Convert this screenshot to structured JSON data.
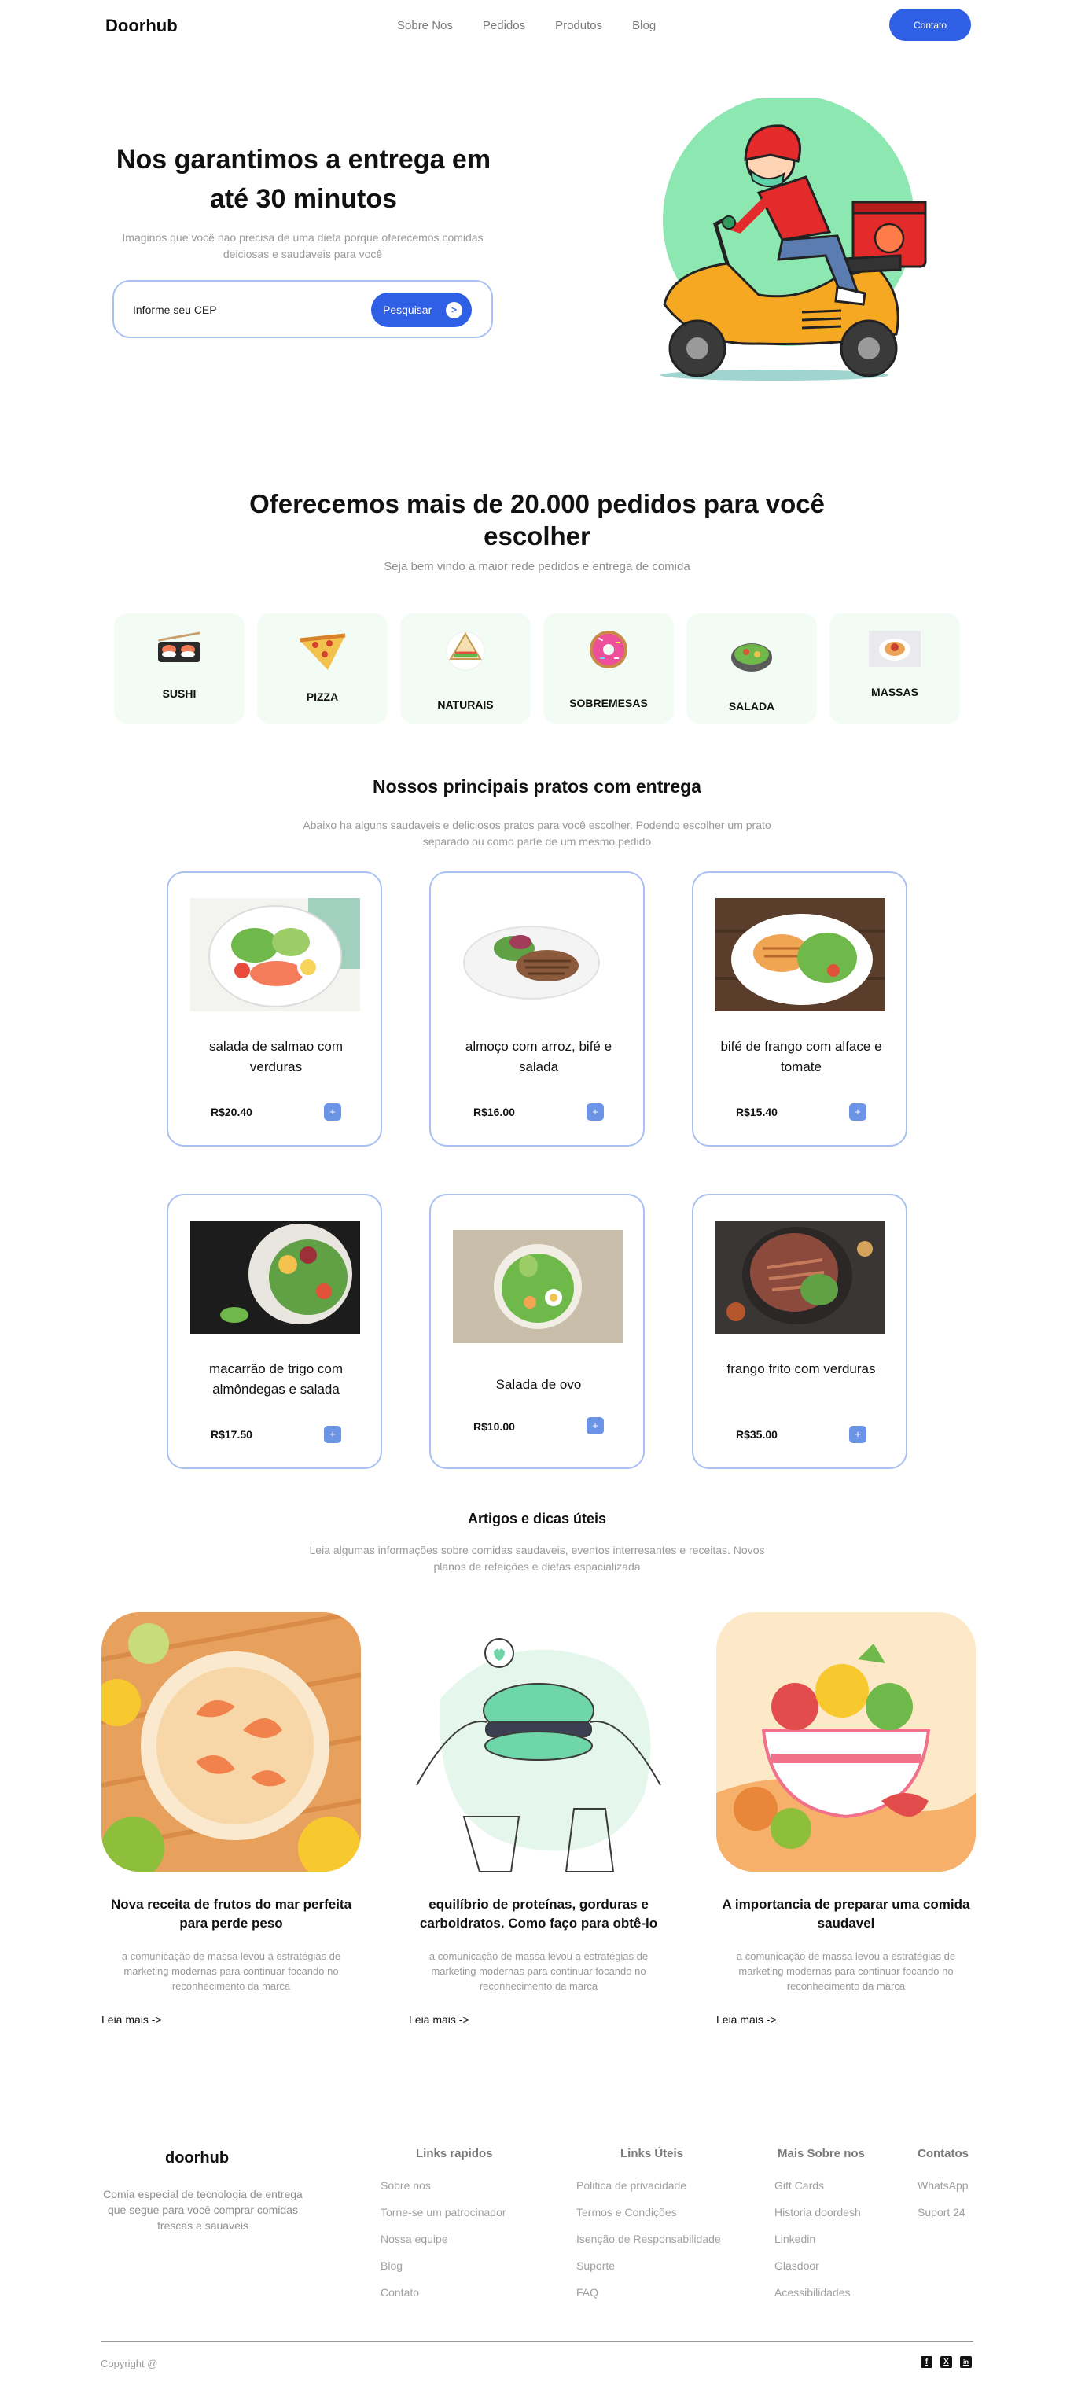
{
  "nav": {
    "brand": "Doorhub",
    "links": [
      "Sobre Nos",
      "Pedidos",
      "Produtos",
      "Blog"
    ],
    "contact_button": "Contato"
  },
  "hero": {
    "title": "Nos garantimos a entrega em até 30 minutos",
    "subtitle": "Imaginos que você nao precisa de uma dieta porque oferecemos comidas deiciosas e saudaveis para você",
    "search_placeholder": "Informe seu CEP",
    "search_button": "Pesquisar",
    "search_arrow": ">"
  },
  "categories_section": {
    "title": "Oferecemos mais de 20.000 pedidos para você escolher",
    "subtitle": "Seja bem vindo a maior rede pedidos e entrega de comida",
    "items": [
      {
        "label": "SUSHI",
        "icon": "sushi-icon"
      },
      {
        "label": "PIZZA",
        "icon": "pizza-icon"
      },
      {
        "label": "NATURAIS",
        "icon": "sandwich-icon"
      },
      {
        "label": "SOBREMESAS",
        "icon": "donut-icon"
      },
      {
        "label": "SALADA",
        "icon": "salad-bowl-icon"
      },
      {
        "label": "MASSAS",
        "icon": "pasta-icon"
      }
    ]
  },
  "dishes_section": {
    "title": "Nossos principais pratos com entrega",
    "subtitle": "Abaixo ha alguns saudaveis e deliciosos pratos para você escolher. Podendo escolher um prato separado ou como parte de um mesmo pedido",
    "add_label": "+",
    "items": [
      {
        "name": "salada de salmao com verduras",
        "price": "R$20.40"
      },
      {
        "name": "almoço com arroz, bifé e salada",
        "price": "R$16.00"
      },
      {
        "name": "bifé de frango com alface e tomate",
        "price": "R$15.40"
      },
      {
        "name": "macarrão de trigo com almôndegas e salada",
        "price": "R$17.50"
      },
      {
        "name": "Salada de ovo",
        "price": "R$10.00"
      },
      {
        "name": "frango frito com verduras",
        "price": "R$35.00"
      }
    ]
  },
  "articles_section": {
    "title": "Artigos e dicas úteis",
    "subtitle": "Leia algumas informações sobre comidas saudaveis, eventos interresantes e receitas. Novos planos de refeições e dietas espacializada",
    "read_more": "Leia mais  ->",
    "items": [
      {
        "title": "Nova receita de frutos do mar perfeita para perde peso",
        "excerpt": "a comunicação de massa levou a estratégias de marketing modernas para continuar focando no reconhecimento da marca"
      },
      {
        "title": "equilíbrio de proteínas, gorduras e carboidratos. Como faço para obtê-lo",
        "excerpt": "a comunicação de massa levou a estratégias de marketing modernas para continuar focando no reconhecimento da marca"
      },
      {
        "title": "A importancia de preparar uma comida saudavel",
        "excerpt": "a comunicação de massa levou a estratégias de marketing modernas para continuar focando no reconhecimento da marca"
      }
    ]
  },
  "footer": {
    "brand": "doorhub",
    "description": "Comia especial de tecnologia de entrega que segue para você comprar comidas frescas e sauaveis",
    "columns": [
      {
        "title": "Links rapidos",
        "links": [
          "Sobre nos",
          "Torne-se um patrocinador",
          "Nossa equipe",
          "Blog",
          "Contato"
        ]
      },
      {
        "title": "Links Úteis",
        "links": [
          "Politica de privacidade",
          "Termos e Condições",
          "Isenção de Responsabilidade",
          "Suporte",
          "FAQ"
        ]
      },
      {
        "title": "Mais Sobre nos",
        "links": [
          "Gift Cards",
          "Historia doordesh",
          "Linkedin",
          "Glasdoor",
          "Acessibilidades"
        ]
      },
      {
        "title": "Contatos",
        "links": [
          "WhatsApp",
          "Suport 24"
        ]
      }
    ],
    "copyright": "Copyright @",
    "social_icons": [
      "facebook-icon",
      "x-icon",
      "linkedin-icon"
    ],
    "social_glyphs": [
      "f",
      "X",
      "in"
    ]
  },
  "colors": {
    "accent": "#2f5fe4",
    "card_border": "#a9c0f2",
    "category_bg": "#f2fcf5",
    "add_button": "#6b93e6"
  }
}
